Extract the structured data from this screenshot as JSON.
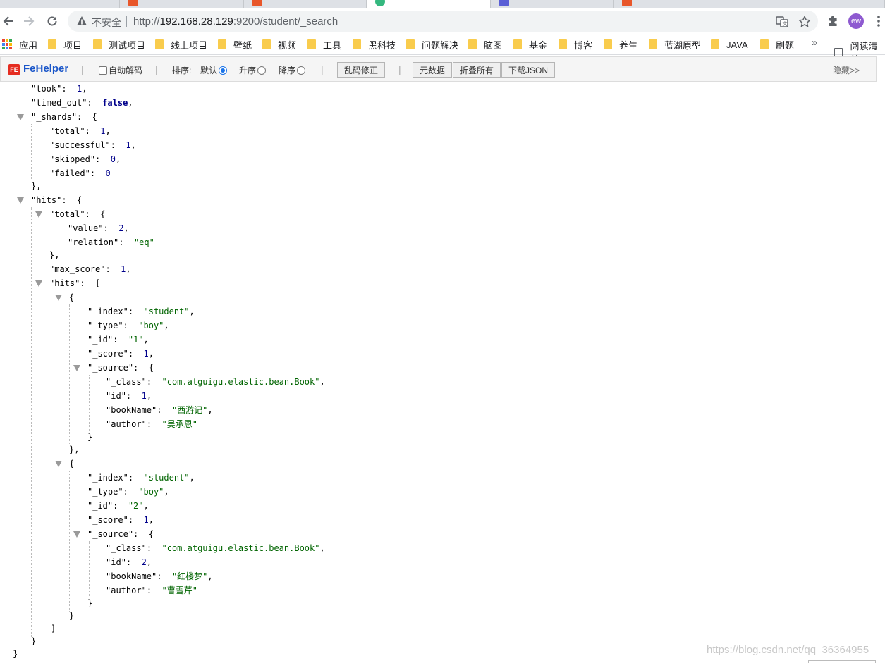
{
  "browser": {
    "address": {
      "security_label": "不安全",
      "url_host": "192.168.28.129",
      "url_rest": ":9200/student/_search",
      "url_scheme": "http://"
    },
    "avatar_initials": "ew",
    "bookmarks": {
      "apps_label": "应用",
      "folders": [
        "项目",
        "测试项目",
        "线上项目",
        "壁纸",
        "视频",
        "工具",
        "黑科技",
        "问题解决",
        "脑图",
        "基金",
        "博客",
        "养生",
        "蓝湖原型",
        "JAVA",
        "刷题"
      ],
      "more_label": "»",
      "reading_list_label": "阅读清单"
    }
  },
  "fehelper": {
    "name": "FeHelper",
    "auto_decode_label": "自动解码",
    "sort_label": "排序:",
    "sort_options": [
      "默认",
      "升序",
      "降序"
    ],
    "fix_garbled_label": "乱码修正",
    "meta_label": "元数据",
    "fold_all_label": "折叠所有",
    "download_label": "下载JSON",
    "hide_label": "隐藏>>"
  },
  "json_lines": [
    {
      "k": "took",
      "v": "1",
      "t": "n",
      "c": ","
    },
    {
      "k": "timed_out",
      "v": "false",
      "t": "b",
      "c": ","
    },
    {
      "k": "_shards",
      "o": "{"
    },
    {
      "k": "total",
      "v": "1",
      "t": "n",
      "c": ","
    },
    {
      "k": "successful",
      "v": "1",
      "t": "n",
      "c": ","
    },
    {
      "k": "skipped",
      "v": "0",
      "t": "n",
      "c": ","
    },
    {
      "k": "failed",
      "v": "0",
      "t": "n",
      "c": ""
    },
    {
      "p": "},"
    },
    {
      "k": "hits",
      "o": "{"
    },
    {
      "k": "total",
      "o": "{"
    },
    {
      "k": "value",
      "v": "2",
      "t": "n",
      "c": ","
    },
    {
      "k": "relation",
      "v": "\"eq\"",
      "t": "s",
      "c": ""
    },
    {
      "p": "},"
    },
    {
      "k": "max_score",
      "v": "1",
      "t": "n",
      "c": ","
    },
    {
      "k": "hits",
      "o": "["
    },
    {
      "o": "{"
    },
    {
      "k": "_index",
      "v": "\"student\"",
      "t": "s",
      "c": ","
    },
    {
      "k": "_type",
      "v": "\"boy\"",
      "t": "s",
      "c": ","
    },
    {
      "k": "_id",
      "v": "\"1\"",
      "t": "s",
      "c": ","
    },
    {
      "k": "_score",
      "v": "1",
      "t": "n",
      "c": ","
    },
    {
      "k": "_source",
      "o": "{"
    },
    {
      "k": "_class",
      "v": "\"com.atguigu.elastic.bean.Book\"",
      "t": "s",
      "c": ","
    },
    {
      "k": "id",
      "v": "1",
      "t": "n",
      "c": ","
    },
    {
      "k": "bookName",
      "v": "\"西游记\"",
      "t": "s",
      "c": ","
    },
    {
      "k": "author",
      "v": "\"吴承恩\"",
      "t": "s",
      "c": ""
    },
    {
      "p": "}"
    },
    {
      "p": "},"
    },
    {
      "o": "{"
    },
    {
      "k": "_index",
      "v": "\"student\"",
      "t": "s",
      "c": ","
    },
    {
      "k": "_type",
      "v": "\"boy\"",
      "t": "s",
      "c": ","
    },
    {
      "k": "_id",
      "v": "\"2\"",
      "t": "s",
      "c": ","
    },
    {
      "k": "_score",
      "v": "1",
      "t": "n",
      "c": ","
    },
    {
      "k": "_source",
      "o": "{"
    },
    {
      "k": "_class",
      "v": "\"com.atguigu.elastic.bean.Book\"",
      "t": "s",
      "c": ","
    },
    {
      "k": "id",
      "v": "2",
      "t": "n",
      "c": ","
    },
    {
      "k": "bookName",
      "v": "\"红楼梦\"",
      "t": "s",
      "c": ","
    },
    {
      "k": "author",
      "v": "\"曹雪芹\"",
      "t": "s",
      "c": ""
    },
    {
      "p": "}"
    },
    {
      "p": "}"
    },
    {
      "p": "]"
    },
    {
      "p": "}"
    },
    {
      "p": "}"
    }
  ],
  "watermark": "https://blog.csdn.net/qq_36364955"
}
